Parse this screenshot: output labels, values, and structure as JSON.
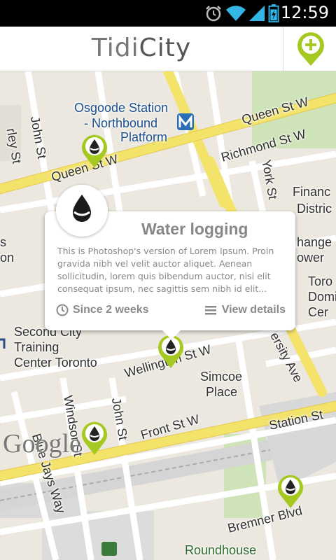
{
  "status_bar": {
    "time": "12:59",
    "icons": [
      "alarm-icon",
      "wifi-icon",
      "signal-icon",
      "battery-icon"
    ]
  },
  "app_bar": {
    "title_part1": "Tidi",
    "title_part2": "City",
    "add_icon": "add-location-icon"
  },
  "map": {
    "labels": {
      "osgoode": "Osgoode Station",
      "northbound": "- Northbound",
      "platform": "Platform",
      "queen_st_w_top": "Queen St W",
      "queen_st_w_left": "Queen St W",
      "richmond": "Richmond St W",
      "john_st_top": "John St",
      "york_st": "York St",
      "finance": "Financ",
      "district": "Distric",
      "change": "hange",
      "tower": "ower",
      "toro": "Toro",
      "domin": "Domin",
      "cer": "Cer",
      "second_city": "Second City",
      "training": "Training",
      "center_toronto": "Center Toronto",
      "wellington": "Wellington St W",
      "simcoe": "Simcoe",
      "place": "Place",
      "windsor": "Windsor St",
      "john_st_bottom": "John St",
      "front_st_w": "Front St W",
      "station_st": "Station St",
      "blue_jays": "Blue Jays Way",
      "bremner": "Bremner Blvd",
      "roundhouse": "Roundhouse",
      "university": "ersity Ave",
      "left_edge_s": "s",
      "left_edge_on": "on",
      "left_edge_ley": "rley St"
    },
    "attribution": "Google",
    "accent_color": "#a5c921"
  },
  "popup": {
    "title": "Water logging",
    "description": "This is Photoshop's version  of Lorem Ipsum. Proin gravida nibh vel velit auctor aliquet. Aenean sollicitudin, lorem quis bibendum auctor, nisi elit consequat ipsum, nec sagittis sem nibh id elit...",
    "since": "Since 2 weeks",
    "view_details": "View details"
  }
}
